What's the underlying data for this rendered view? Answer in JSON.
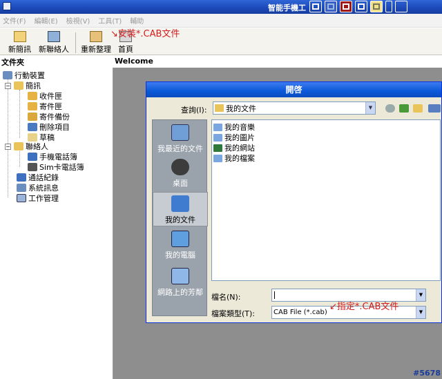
{
  "window": {
    "title": "智能手機工"
  },
  "menu": [
    "文件(F)",
    "編輯(E)",
    "檢視(V)",
    "工具(T)",
    "輔助"
  ],
  "toolbar": {
    "new_sms": "新簡訊",
    "new_contact": "新聯絡人",
    "refresh": "重新整理",
    "home": "首頁"
  },
  "annotation_top": "↘安裝*.CAB文件",
  "annotation_bottom": "↙指定*.CAB文件",
  "left_pane": {
    "header": "文件夾",
    "tree": {
      "root": "行動裝置",
      "sms": "簡訊",
      "inbox": "收件匣",
      "outbox": "寄件匣",
      "sent": "寄件備份",
      "deleted": "刪除項目",
      "drafts": "草稿",
      "contacts": "聯絡人",
      "phonebook": "手機電話簿",
      "sim_phonebook": "Sim卡電話簿",
      "call_log": "通話紀錄",
      "system_info": "系統訊息",
      "task_manager": "工作管理"
    }
  },
  "right_pane": {
    "header": "Welcome",
    "watermark": "#5678"
  },
  "dialog": {
    "title": "開啓",
    "look_in_label": "查詢(I):",
    "look_in_value": "我的文件",
    "places": [
      "我最近的文件",
      "桌面",
      "我的文件",
      "我的電腦",
      "網路上的芳鄰"
    ],
    "files": [
      "我的音樂",
      "我的圖片",
      "我的網站",
      "我的檔案"
    ],
    "filename_label": "檔名(N):",
    "filename_value": "",
    "filetype_label": "檔案類型(T):",
    "filetype_value": "CAB File (*.cab)"
  },
  "colors": {
    "accent": "#1c48b8",
    "annotation": "#d31b1b",
    "workspace": "#8e8e8e"
  }
}
